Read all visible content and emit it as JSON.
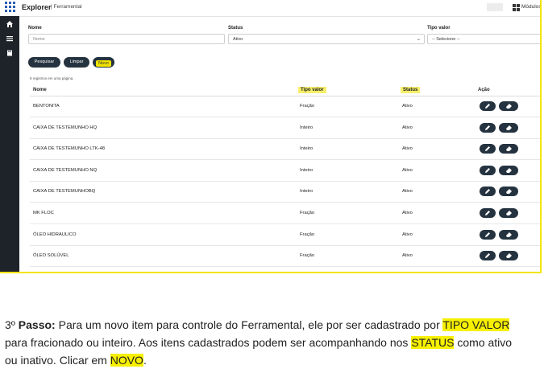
{
  "app": {
    "brand": "Explorer",
    "subtitle": "| Ferramental",
    "modules_label": "Módulos",
    "modules_icon": "grid-icon"
  },
  "sidebar": {
    "icons": [
      "home-icon",
      "menu-icon",
      "book-icon"
    ]
  },
  "filters": {
    "nome_label": "Nome",
    "nome_placeholder": "Nome",
    "status_label": "Status",
    "status_value": "Ativo",
    "tipo_label": "Tipo valor",
    "tipo_value": "-- Selecione --"
  },
  "buttons": {
    "pesquisar": "Pesquisar",
    "limpar": "Limpar",
    "novo": "Novo"
  },
  "record_count": "8 registros em uma página.",
  "table": {
    "headers": {
      "nome": "Nome",
      "tipo": "Tipo valor",
      "status": "Status",
      "acao": "Ação"
    },
    "rows": [
      {
        "nome": "BENTONITA",
        "tipo": "Fração",
        "status": "Ativo"
      },
      {
        "nome": "CAIXA DE TESTEMUNHO HQ",
        "tipo": "Inteiro",
        "status": "Ativo"
      },
      {
        "nome": "CAIXA DE TESTEMUNHO LTK-48",
        "tipo": "Inteiro",
        "status": "Ativo"
      },
      {
        "nome": "CAIXA DE TESTEMUNHO NQ",
        "tipo": "Inteiro",
        "status": "Ativo"
      },
      {
        "nome": "CAIXA DE TESTEMUNHOBQ",
        "tipo": "Inteiro",
        "status": "Ativo"
      },
      {
        "nome": "MK FLOC",
        "tipo": "Fração",
        "status": "Ativo"
      },
      {
        "nome": "ÓLEO HIDRAULICO",
        "tipo": "Fração",
        "status": "Ativo"
      },
      {
        "nome": "ÓLEO SOLÚVEL",
        "tipo": "Fração",
        "status": "Ativo"
      }
    ],
    "row_actions": [
      "pencil-icon",
      "eraser-icon"
    ]
  },
  "instruction": {
    "step": "3º ",
    "passo": "Passo:",
    "t1": " Para um novo item para controle do Ferramental, ele por ser cadastrado por ",
    "h1": "TIPO VALOR",
    "t2": " para fracionado ou inteiro. Aos itens cadastrados podem ser acompanhando nos ",
    "h2": "STATUS",
    "t3": " como ativo ou inativo. Clicar em ",
    "h3": "NOVO",
    "t4": "."
  },
  "colors": {
    "highlight": "#f7f000",
    "sidebar": "#1e2329",
    "button": "#253340"
  }
}
